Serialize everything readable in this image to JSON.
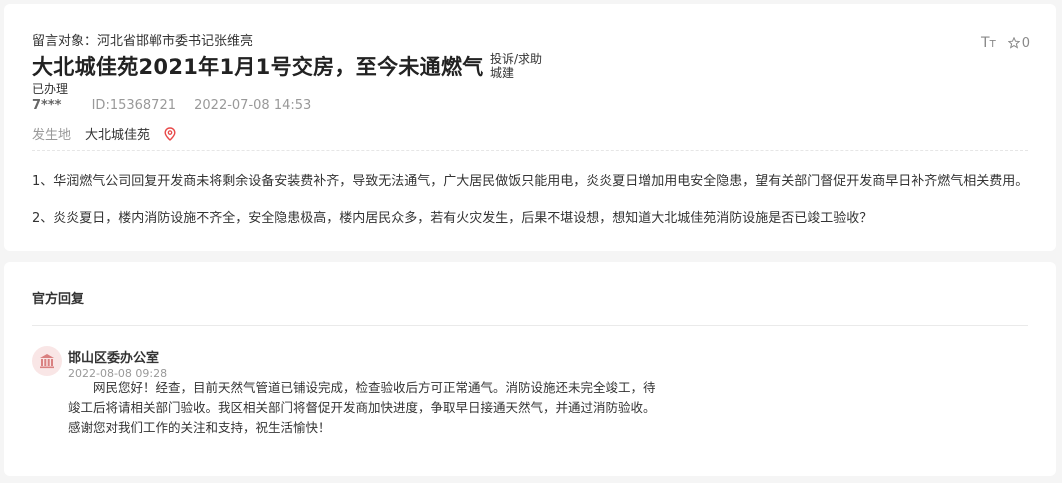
{
  "message": {
    "recipient": "留言对象：河北省邯郸市委书记张维亮",
    "title": "大北城佳苑2021年1月1号交房，至今未通燃气",
    "tag_type": "投诉/求助",
    "tag_category": "城建",
    "status": "已办理",
    "author": "7***",
    "id": "ID:15368721",
    "datetime": "2022-07-08 14:53",
    "location_label": "发生地",
    "location_value": "大北城佳苑",
    "favorite_count": "0",
    "paragraphs": [
      "1、华润燃气公司回复开发商未将剩余设备安装费补齐，导致无法通气，广大居民做饭只能用电，炎炎夏日增加用电安全隐患，望有关部门督促开发商早日补齐燃气相关费用。",
      "2、炎炎夏日，楼内消防设施不齐全，安全隐患极高，楼内居民众多，若有火灾发生，后果不堪设想，想知道大北城佳苑消防设施是否已竣工验收？"
    ]
  },
  "reply": {
    "heading": "官方回复",
    "org_name": "邯山区委办公室",
    "datetime": "2022-08-08 09:28",
    "content": "网民您好！经查，目前天然气管道已铺设完成，检查验收后方可正常通气。消防设施还未完全竣工，待竣工后将请相关部门验收。我区相关部门将督促开发商加快进度，争取早日接通天然气，并通过消防验收。感谢您对我们工作的关注和支持，祝生活愉快！"
  },
  "icons": {
    "font_size": "font-size-icon",
    "favorite": "star-icon",
    "location": "location-pin-icon",
    "org": "government-building-icon"
  },
  "colors": {
    "pin": "#e84a4a",
    "avatar_bg": "#f9e6e6",
    "avatar_icon": "#d98080"
  }
}
